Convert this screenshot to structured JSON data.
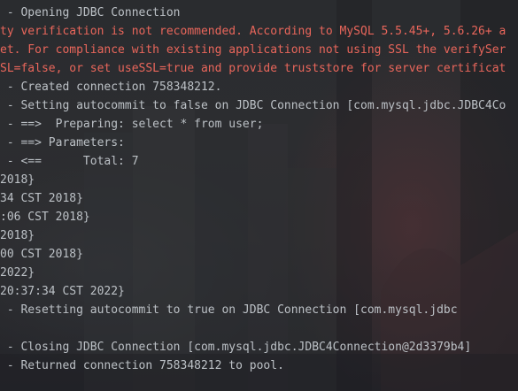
{
  "console": {
    "lines": [
      {
        "text": " - Opening JDBC Connection",
        "kind": "info"
      },
      {
        "text": "ty verification is not recommended. According to MySQL 5.5.45+, 5.6.26+ a",
        "kind": "error"
      },
      {
        "text": "et. For compliance with existing applications not using SSL the verifySer",
        "kind": "error"
      },
      {
        "text": "SL=false, or set useSSL=true and provide truststore for server certificat",
        "kind": "error"
      },
      {
        "text": " - Created connection 758348212.",
        "kind": "info"
      },
      {
        "text": " - Setting autocommit to false on JDBC Connection [com.mysql.jdbc.JDBC4Co",
        "kind": "info"
      },
      {
        "text": " - ==>  Preparing: select * from user;",
        "kind": "info"
      },
      {
        "text": " - ==> Parameters:",
        "kind": "info"
      },
      {
        "text": " - <==      Total: 7",
        "kind": "info"
      },
      {
        "text": "2018}",
        "kind": "info"
      },
      {
        "text": "34 CST 2018}",
        "kind": "info"
      },
      {
        "text": ":06 CST 2018}",
        "kind": "info"
      },
      {
        "text": "2018}",
        "kind": "info"
      },
      {
        "text": "00 CST 2018}",
        "kind": "info"
      },
      {
        "text": "2022}",
        "kind": "info"
      },
      {
        "text": "20:37:34 CST 2022}",
        "kind": "info"
      },
      {
        "text": " - Resetting autocommit to true on JDBC Connection [com.mysql.jdbc",
        "kind": "info"
      },
      {
        "text": "",
        "kind": "blank"
      },
      {
        "text": " - Closing JDBC Connection [com.mysql.jdbc.JDBC4Connection@2d3379b4]",
        "kind": "info"
      },
      {
        "text": " - Returned connection 758348212 to pool.",
        "kind": "info"
      }
    ]
  },
  "colors": {
    "background": "#26282b",
    "info_text": "#bcc1c6",
    "error_text": "#e9665b"
  }
}
